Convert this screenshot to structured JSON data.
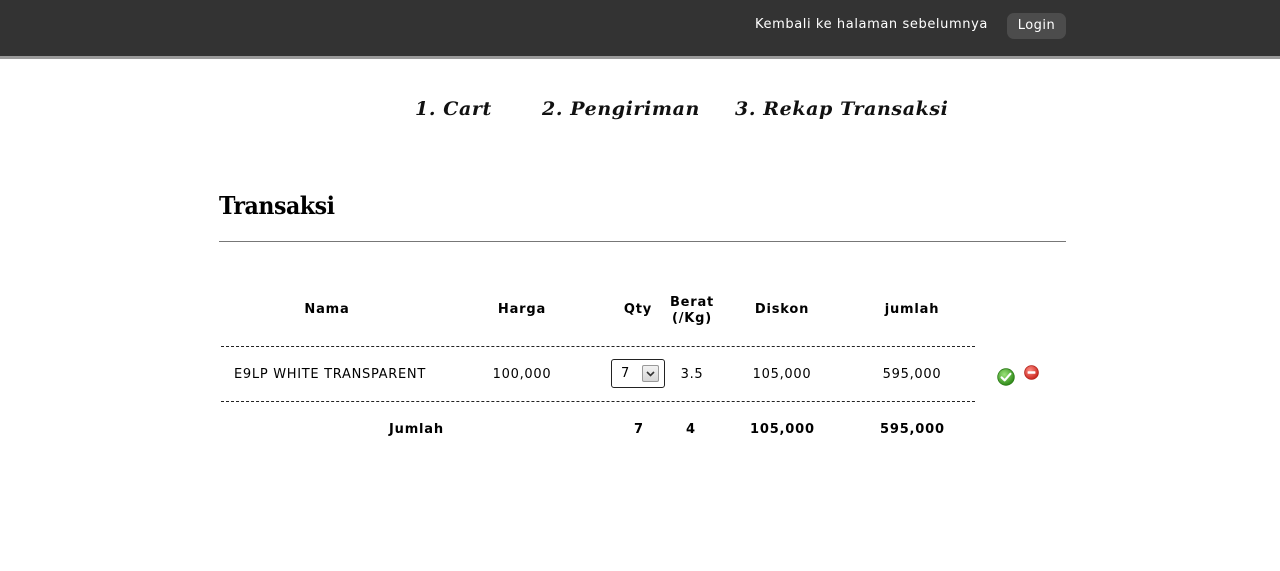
{
  "header": {
    "back_link": "Kembali ke halaman sebelumnya",
    "login_label": "Login",
    "bar_color": "#333333"
  },
  "steps": [
    {
      "label": "1. Cart"
    },
    {
      "label": "2. Pengiriman"
    },
    {
      "label": "3. Rekap Transaksi"
    }
  ],
  "section": {
    "title": "Transaksi"
  },
  "table": {
    "columns": {
      "nama": "Nama",
      "harga": "Harga",
      "qty": "Qty",
      "berat_line1": "Berat",
      "berat_line2": "(/Kg)",
      "diskon": "Diskon",
      "jumlah": "jumlah"
    },
    "rows": [
      {
        "nama": "E9LP WHITE TRANSPARENT",
        "harga": "100,000",
        "qty": "7",
        "berat": "3.5",
        "diskon": "105,000",
        "jumlah": "595,000",
        "actions": [
          "check-icon",
          "remove-icon"
        ]
      }
    ],
    "totals": {
      "label": "Jumlah",
      "qty": "7",
      "berat": "4",
      "diskon": "105,000",
      "jumlah": "595,000"
    }
  },
  "colors": {
    "accept": "#3f9a24",
    "remove": "#d9342b"
  }
}
